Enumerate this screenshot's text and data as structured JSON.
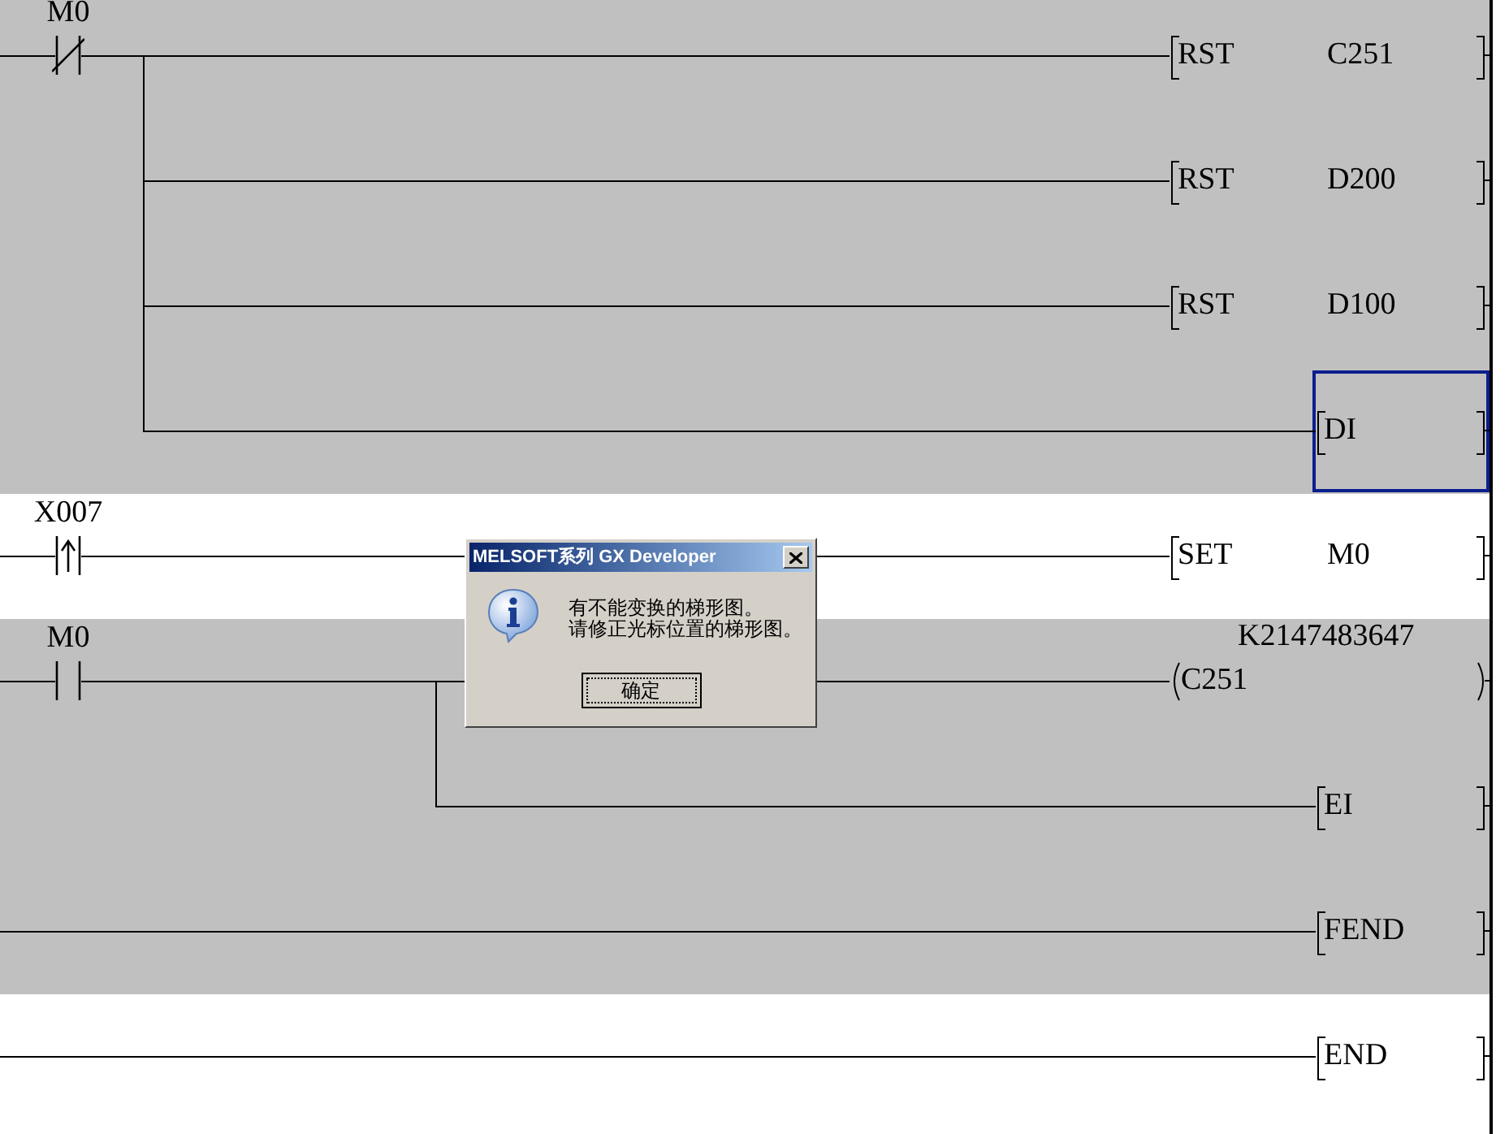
{
  "rungs": [
    {
      "shaded": true,
      "contact": {
        "kind": "nc",
        "label": "M0"
      },
      "outputs": [
        {
          "kind": "instruction",
          "name": "RST",
          "operand": "C251",
          "selected": false
        },
        {
          "kind": "instruction",
          "name": "RST",
          "operand": "D200",
          "selected": false
        },
        {
          "kind": "instruction",
          "name": "RST",
          "operand": "D100",
          "selected": false
        },
        {
          "kind": "instruction",
          "name": "DI",
          "selected": true
        }
      ]
    },
    {
      "shaded": false,
      "contact": {
        "kind": "pulse",
        "label": "X007"
      },
      "outputs": [
        {
          "kind": "instruction",
          "name": "SET",
          "operand": "M0",
          "selected": false
        }
      ]
    },
    {
      "shaded": true,
      "contact": {
        "kind": "no",
        "label": "M0"
      },
      "outputs": [
        {
          "kind": "coil",
          "name": "C251",
          "setting": "K2147483647",
          "selected": false
        },
        {
          "kind": "instruction",
          "name": "EI",
          "selected": false
        }
      ]
    },
    {
      "shaded": true,
      "outputs": [
        {
          "kind": "instruction",
          "name": "FEND",
          "selected": false
        }
      ]
    },
    {
      "shaded": false,
      "outputs": [
        {
          "kind": "instruction",
          "name": "END",
          "selected": false
        }
      ]
    }
  ],
  "dialog": {
    "title": "MELSOFT系列 GX Developer",
    "message": [
      "有不能变换的梯形图。",
      "请修正光标位置的梯形图。"
    ],
    "button": "确定"
  }
}
